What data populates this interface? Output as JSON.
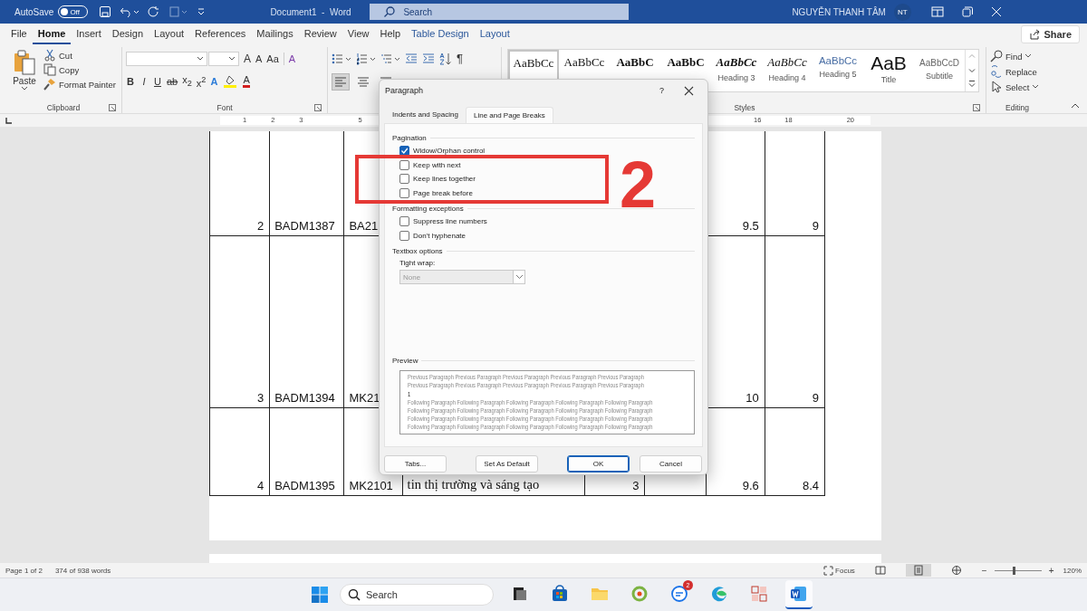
{
  "title_bar": {
    "autosave_label": "AutoSave",
    "autosave": {
      "on": false,
      "label": "Off"
    },
    "document_title": "Document1  -  Word",
    "search": {
      "placeholder": "Search"
    },
    "user_name": "NGUYỄN THANH TÂM",
    "avatar_initials": "NT"
  },
  "ribbon_tabs": [
    {
      "label": "File",
      "selected": false,
      "kind": "plain"
    },
    {
      "label": "Home",
      "selected": true,
      "kind": "plain"
    },
    {
      "label": "Insert",
      "selected": false,
      "kind": "plain"
    },
    {
      "label": "Design",
      "selected": false,
      "kind": "plain"
    },
    {
      "label": "Layout",
      "selected": false,
      "kind": "plain"
    },
    {
      "label": "References",
      "selected": false,
      "kind": "plain"
    },
    {
      "label": "Mailings",
      "selected": false,
      "kind": "plain"
    },
    {
      "label": "Review",
      "selected": false,
      "kind": "plain"
    },
    {
      "label": "View",
      "selected": false,
      "kind": "plain"
    },
    {
      "label": "Help",
      "selected": false,
      "kind": "plain"
    },
    {
      "label": "Table Design",
      "selected": false,
      "kind": "contextual"
    },
    {
      "label": "Layout",
      "selected": false,
      "kind": "contextual"
    }
  ],
  "share_button": "Share",
  "ribbon": {
    "clipboard": {
      "label": "Clipboard",
      "paste": "Paste",
      "items": [
        "Cut",
        "Copy",
        "Format Painter"
      ]
    },
    "font": {
      "label": "Font",
      "grow": "A",
      "shrink": "A",
      "change_case": "Aa",
      "clear": "A",
      "format_buttons": [
        "B",
        "I",
        "U",
        "ab",
        "x$_{2}$",
        "x$^{2}$"
      ],
      "effects": "A",
      "font_color": "A"
    },
    "paragraph": {
      "pilcrow": "¶",
      "alignments": [
        {
          "kind": "left",
          "selected": true
        },
        {
          "kind": "center",
          "selected": false
        },
        {
          "kind": "right",
          "selected": false
        }
      ]
    },
    "styles": {
      "label": "Styles",
      "items": [
        {
          "sample": "AaBbCc",
          "kind": "normal",
          "selected": true
        },
        {
          "sample": "AaBbCc",
          "kind": "normal",
          "selected": false
        },
        {
          "sample": "AaBbC",
          "kind": "bold",
          "selected": false
        },
        {
          "sample": "AaBbC",
          "kind": "bold",
          "selected": false
        },
        {
          "sample": "AaBbCc",
          "kind": "bolditalic",
          "label": "Heading 3",
          "selected": false
        },
        {
          "sample": "AaBbCc",
          "kind": "italic",
          "label": "Heading 4",
          "selected": false
        },
        {
          "sample": "AaBbCc",
          "kind": "blue",
          "label": "Heading 5",
          "selected": false
        },
        {
          "sample": "AaB",
          "kind": "title",
          "label": "Title",
          "selected": false
        },
        {
          "sample": "AaBbCcD",
          "kind": "subtitle",
          "label": "Subtitle",
          "selected": false
        }
      ]
    },
    "editing": {
      "label": "Editing",
      "items": [
        "Find",
        "Replace",
        "Select"
      ]
    }
  },
  "ruler": {
    "left_numbers": [
      "1",
      "2",
      "3",
      "5"
    ],
    "right_numbers": [
      "16",
      "18",
      "20"
    ]
  },
  "document": {
    "rows": [
      [
        "2",
        "BADM1387",
        "BA21",
        null,
        null,
        null,
        "9.5",
        "9"
      ],
      [
        "3",
        "BADM1394",
        "MK21",
        null,
        null,
        null,
        "10",
        "9"
      ],
      [
        "4",
        "BADM1395",
        "MK2101",
        "tin thị trường và sáng tạo",
        "3",
        null,
        "9.6",
        "8.4"
      ]
    ]
  },
  "dialog": {
    "title": "Paragraph",
    "help": "?",
    "tabs": [
      {
        "label": "Indents and Spacing",
        "selected": false
      },
      {
        "label": "Line and Page Breaks",
        "selected": true
      }
    ],
    "sections": [
      {
        "title": "Pagination",
        "checkboxes": [
          {
            "label": "Widow/Orphan control",
            "checked": true
          },
          {
            "label": "Keep with next",
            "checked": false
          },
          {
            "label": "Keep lines together",
            "checked": false
          },
          {
            "label": "Page break before",
            "checked": false
          }
        ]
      },
      {
        "title": "Formatting exceptions",
        "checkboxes": [
          {
            "label": "Suppress line numbers",
            "checked": false
          },
          {
            "label": "Don't hyphenate",
            "checked": false
          }
        ]
      }
    ],
    "textbox": {
      "title": "Textbox options",
      "field_label": "Tight wrap:",
      "value": "None",
      "disabled": true
    },
    "preview": {
      "title": "Preview",
      "previous_lines": [
        "Previous Paragraph Previous Paragraph Previous Paragraph Previous Paragraph Previous Paragraph",
        "Previous Paragraph Previous Paragraph Previous Paragraph Previous Paragraph Previous Paragraph"
      ],
      "current": "1",
      "following_lines": [
        "Following Paragraph Following Paragraph Following Paragraph Following Paragraph Following Paragraph",
        "Following Paragraph Following Paragraph Following Paragraph Following Paragraph Following Paragraph",
        "Following Paragraph Following Paragraph Following Paragraph Following Paragraph Following Paragraph",
        "Following Paragraph Following Paragraph Following Paragraph Following Paragraph Following Paragraph"
      ]
    },
    "buttons": [
      {
        "label": "Tabs...",
        "default": false
      },
      {
        "label": "Set As Default",
        "default": false
      },
      {
        "label": "OK",
        "default": true
      },
      {
        "label": "Cancel",
        "default": false
      }
    ]
  },
  "annotation": {
    "label": "2"
  },
  "status_bar": {
    "page": "Page 1 of 2",
    "words": "374 of 938 words",
    "focus": "Focus",
    "views": [
      {
        "selected": false
      },
      {
        "selected": true
      },
      {
        "selected": false
      }
    ],
    "zoom_out": "−",
    "zoom_in": "+",
    "zoom": {
      "level": 0.4
    },
    "zoom_percent": "120%"
  },
  "taskbar": {
    "search": {
      "placeholder": "Search"
    },
    "apps": [
      {
        "kind": "taskview",
        "active": false
      },
      {
        "kind": "store",
        "active": false
      },
      {
        "kind": "folder",
        "active": false
      },
      {
        "kind": "green",
        "active": false
      },
      {
        "kind": "chat",
        "active": false,
        "badge": "2"
      },
      {
        "kind": "edge",
        "active": false
      },
      {
        "kind": "tiles",
        "active": false
      },
      {
        "kind": "word",
        "active": true
      }
    ]
  }
}
